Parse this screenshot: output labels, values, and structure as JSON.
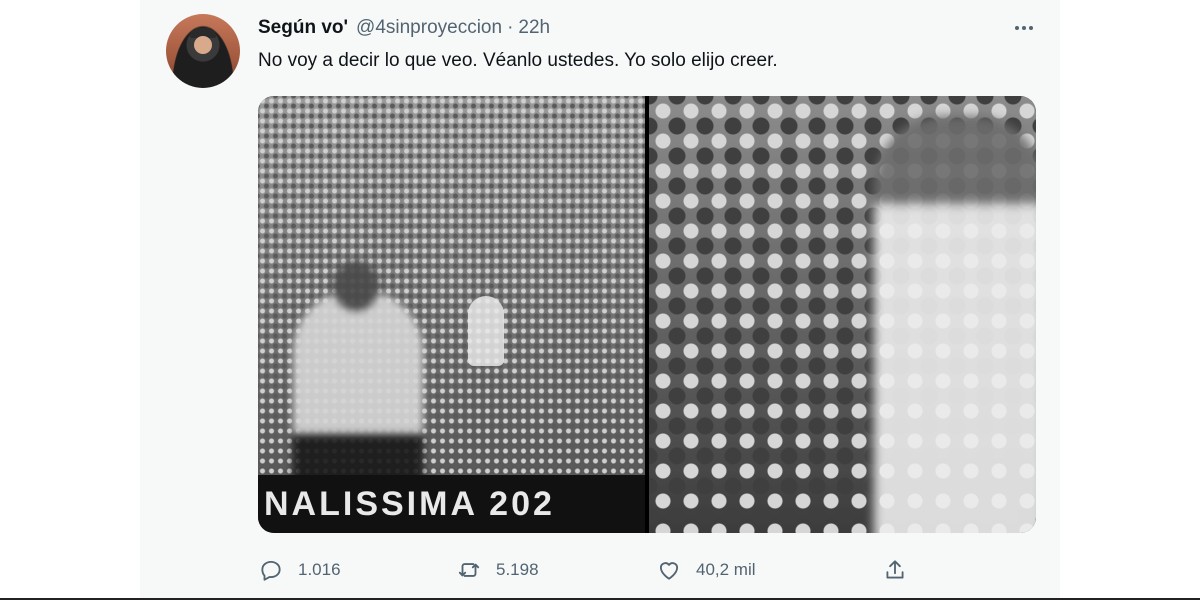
{
  "tweet": {
    "display_name": "Según vo'",
    "handle": "@4sinproyeccion",
    "separator": "·",
    "time": "22h",
    "text": "No voy a decir lo que veo. Véanlo ustedes. Yo solo elijo creer.",
    "media": {
      "left_banner_text": "NALISSIMA 202"
    },
    "actions": {
      "reply_count": "1.016",
      "retweet_count": "5.198",
      "like_count": "40,2 mil"
    }
  },
  "icons": {
    "more": "more-horizontal-icon",
    "reply": "reply-icon",
    "retweet": "retweet-icon",
    "like": "heart-icon",
    "share": "share-icon"
  },
  "colors": {
    "text_primary": "#0f1419",
    "text_secondary": "#536471",
    "card_background": "#f7f9f9"
  }
}
